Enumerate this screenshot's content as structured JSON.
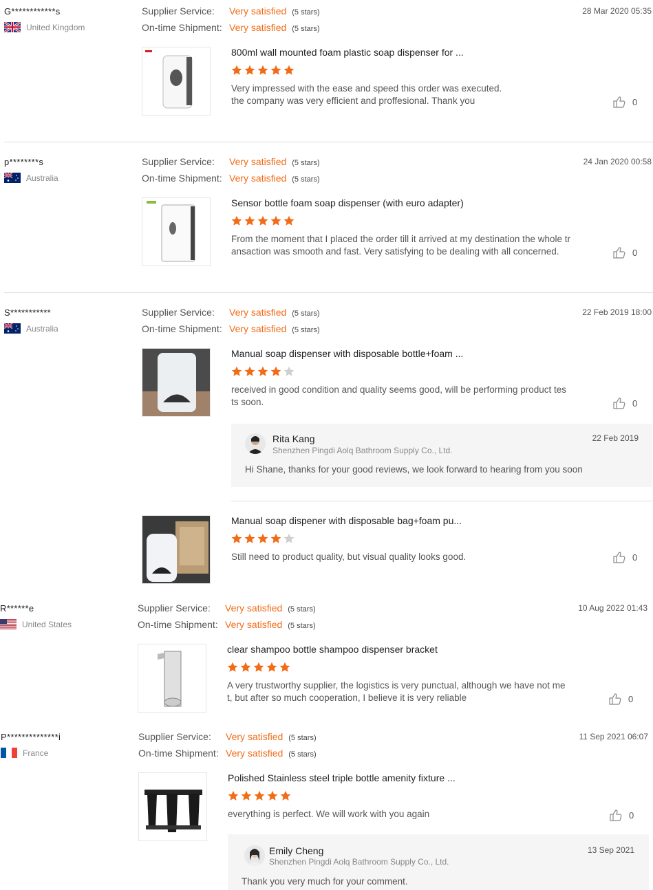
{
  "labels": {
    "supplier_service": "Supplier Service:",
    "ontime_shipment": "On-time Shipment:"
  },
  "colors": {
    "accent": "#f26c18",
    "star_empty": "#cfcfcf"
  },
  "icons": {
    "like": "thumbs-up-icon",
    "star": "star-icon"
  },
  "reviews": [
    {
      "buyer": "G************s",
      "country": "United Kingdom",
      "flag": "uk-flag-icon",
      "supplier_service": "Very satisfied",
      "supplier_stars": "(5 stars)",
      "shipment": "Very satisfied",
      "shipment_stars": "(5 stars)",
      "date": "28 Mar 2020 05:35",
      "product_title": "800ml wall mounted foam plastic soap dispenser for ...",
      "rating": 5,
      "comment_1": "Very impressed with the ease and speed this order was executed.",
      "comment_2": "the company was very efficient and proffesional. Thank you",
      "likes": "0"
    },
    {
      "buyer": "p********s",
      "country": "Australia",
      "flag": "australia-flag-icon",
      "supplier_service": "Very satisfied",
      "supplier_stars": "(5 stars)",
      "shipment": "Very satisfied",
      "shipment_stars": "(5 stars)",
      "date": "24 Jan 2020 00:58",
      "product_title": "Sensor bottle foam soap dispenser (with euro adapter)",
      "rating": 5,
      "comment_1": "From the moment that I placed the order till it arrived at my destination the whole tr",
      "comment_2": "ansaction was smooth and fast.  Very satisfying to be dealing with all concerned.",
      "likes": "0"
    },
    {
      "buyer": "S***********",
      "country": "Australia",
      "flag": "australia-flag-icon",
      "supplier_service": "Very satisfied",
      "supplier_stars": "(5 stars)",
      "shipment": "Very satisfied",
      "shipment_stars": "(5 stars)",
      "date": "22 Feb 2019 18:00",
      "product_title": "Manual soap dispenser with disposable bottle+foam ...",
      "rating": 4,
      "comment_1": "received in good condition and quality seems good, will be performing product tes",
      "comment_2": "ts soon.",
      "likes": "0",
      "reply": {
        "name": "Rita Kang",
        "company": "Shenzhen Pingdi Aolq Bathroom Supply Co., Ltd.",
        "date": "22 Feb 2019",
        "text": "Hi Shane, thanks for your good reviews, we look forward to hearing from you soon"
      },
      "second_product": {
        "product_title": "Manual soap dispener with disposable bag+foam pu...",
        "rating": 4,
        "comment_1": "Still need to product quality, but visual quality looks good.",
        "likes": "0"
      }
    },
    {
      "buyer": "R******e",
      "country": "United States",
      "flag": "usa-flag-icon",
      "supplier_service": "Very satisfied",
      "supplier_stars": "(5 stars)",
      "shipment": "Very satisfied",
      "shipment_stars": "(5 stars)",
      "date": "10 Aug 2022 01:43",
      "product_title": "clear shampoo bottle shampoo dispenser bracket",
      "rating": 5,
      "comment_1": "A very trustworthy supplier, the logistics is very punctual, although we have not me",
      "comment_2": "t, but after so much cooperation, I believe it is very reliable",
      "likes": "0"
    },
    {
      "buyer": "P**************i",
      "country": "France",
      "flag": "france-flag-icon",
      "supplier_service": "Very satisfied",
      "supplier_stars": "(5 stars)",
      "shipment": "Very satisfied",
      "shipment_stars": "(5 stars)",
      "date": "11 Sep 2021 06:07",
      "product_title": "Polished Stainless steel triple bottle amenity fixture ...",
      "rating": 5,
      "comment_1": "everything is perfect. We will work with you again",
      "likes": "0",
      "reply": {
        "name": "Emily Cheng",
        "company": "Shenzhen Pingdi Aolq Bathroom Supply Co., Ltd.",
        "date": "13 Sep 2021",
        "text": "Thank you very much for your comment."
      }
    }
  ]
}
